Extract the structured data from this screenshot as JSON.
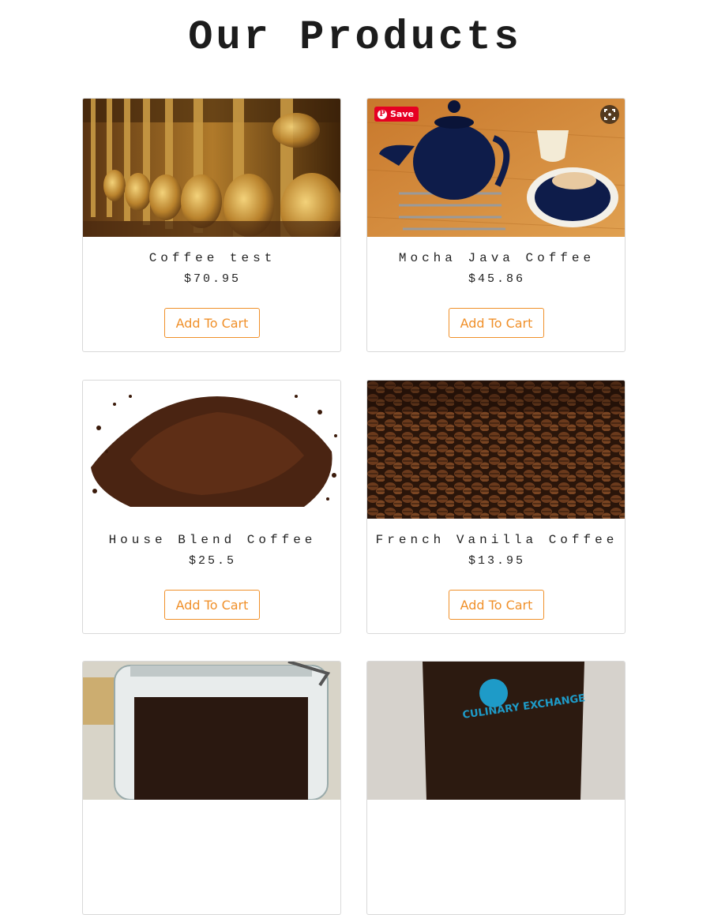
{
  "page": {
    "title": "Our Products"
  },
  "products": [
    {
      "name": "Coffee test",
      "price": "$70.95",
      "button": "Add To Cart",
      "image": "brass-coffee-dispensers-photo"
    },
    {
      "name": "Mocha Java Coffee",
      "price": "$45.86",
      "button": "Add To Cart",
      "image": "teapot-and-cup-photo"
    },
    {
      "name": "House Blend Coffee",
      "price": "$25.5",
      "button": "Add To Cart",
      "image": "ground-coffee-pile-photo"
    },
    {
      "name": "French Vanilla Coffee",
      "price": "$13.95",
      "button": "Add To Cart",
      "image": "roasted-coffee-beans-photo"
    },
    {
      "image": "glass-jar-photo"
    },
    {
      "image": "culinary-exchange-coffee-bag-photo",
      "bag_text": "CULINARY EXCHANGE"
    }
  ],
  "overlay": {
    "pinterest_save": "Save",
    "pinterest_icon": "pinterest-icon",
    "visual_search_icon": "visual-search-icon"
  },
  "colors": {
    "accent": "#f0902a",
    "pinterest": "#e60023",
    "text": "#222222"
  }
}
